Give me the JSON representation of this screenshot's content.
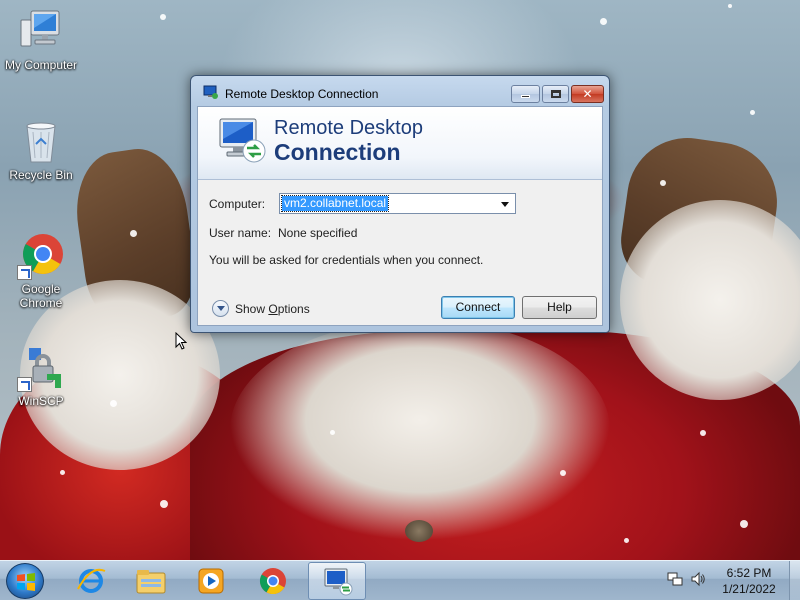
{
  "desktop": {
    "icons": [
      {
        "label": "My Computer",
        "icon": "my-computer-icon"
      },
      {
        "label": "Recycle Bin",
        "icon": "recycle-bin-icon"
      },
      {
        "label_line1": "Google",
        "label_line2": "Chrome",
        "icon": "chrome-icon"
      },
      {
        "label": "WinSCP",
        "icon": "winscp-icon"
      }
    ]
  },
  "window": {
    "title": "Remote Desktop Connection",
    "banner_line1": "Remote Desktop",
    "banner_line2": "Connection",
    "computer_label": "Computer:",
    "computer_value": "vm2.collabnet.local",
    "username_label": "User name:",
    "username_value": "None specified",
    "hint": "You will be asked for credentials when you connect.",
    "show_options_prefix": "Show ",
    "show_options_underlined": "O",
    "show_options_suffix": "ptions",
    "connect_label": "Connect",
    "help_label": "Help"
  },
  "taskbar": {
    "apps": [
      {
        "name": "internet-explorer-icon"
      },
      {
        "name": "windows-explorer-icon"
      },
      {
        "name": "media-player-icon"
      },
      {
        "name": "chrome-icon"
      },
      {
        "name": "remote-desktop-icon",
        "active": true
      }
    ],
    "clock_time": "6:52 PM",
    "clock_date": "1/21/2022"
  },
  "colors": {
    "banner_text": "#1d3d7a",
    "selection": "#3399ff",
    "close_button": "#c23a22"
  }
}
